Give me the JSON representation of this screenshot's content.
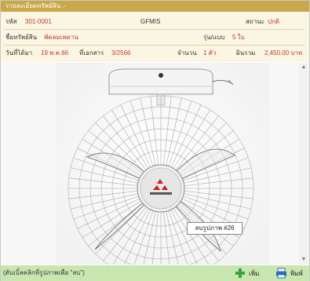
{
  "window": {
    "title": "รายละเอียดทรัพย์สิน .-"
  },
  "info": {
    "code_label": "รหัส",
    "code_value": "301-0001",
    "system": "GFMIS",
    "status_label": "สถานะ",
    "status_value": "ปกติ",
    "name_label": "ชื่อทรัพย์สิน",
    "name_value": "พัดลมเพดาน",
    "model_label": "รุ่น/แบบ",
    "model_value": "5 ใบ",
    "date_label": "วันที่ได้มา",
    "date_value": "19 พ.ค.66",
    "doc_label": "ที่เอกสาร",
    "doc_value": "3/2566",
    "qty_label": "จำนวน",
    "qty_value": "1 ตัว",
    "total_label": "ผินรวม",
    "total_value": "2,450.00 บาท"
  },
  "viewer": {
    "tooltip": "ลบรูปภาพ #26"
  },
  "footer": {
    "hint": "(ดับเบิ้ลคลิกที่รูปภาพเพื่อ \"ลบ\")",
    "add_label": "เพิ่ม",
    "print_label": "พิมพ์"
  },
  "colors": {
    "title_bar": "#c9a84a",
    "info_bg": "#fbf6e3",
    "value_text": "#c0392b",
    "footer_bg": "#c8e6b0",
    "add_icon": "#3aa43a",
    "print_icon": "#2a6fb5"
  },
  "icons": {
    "add": "plus-icon",
    "print": "printer-icon"
  }
}
